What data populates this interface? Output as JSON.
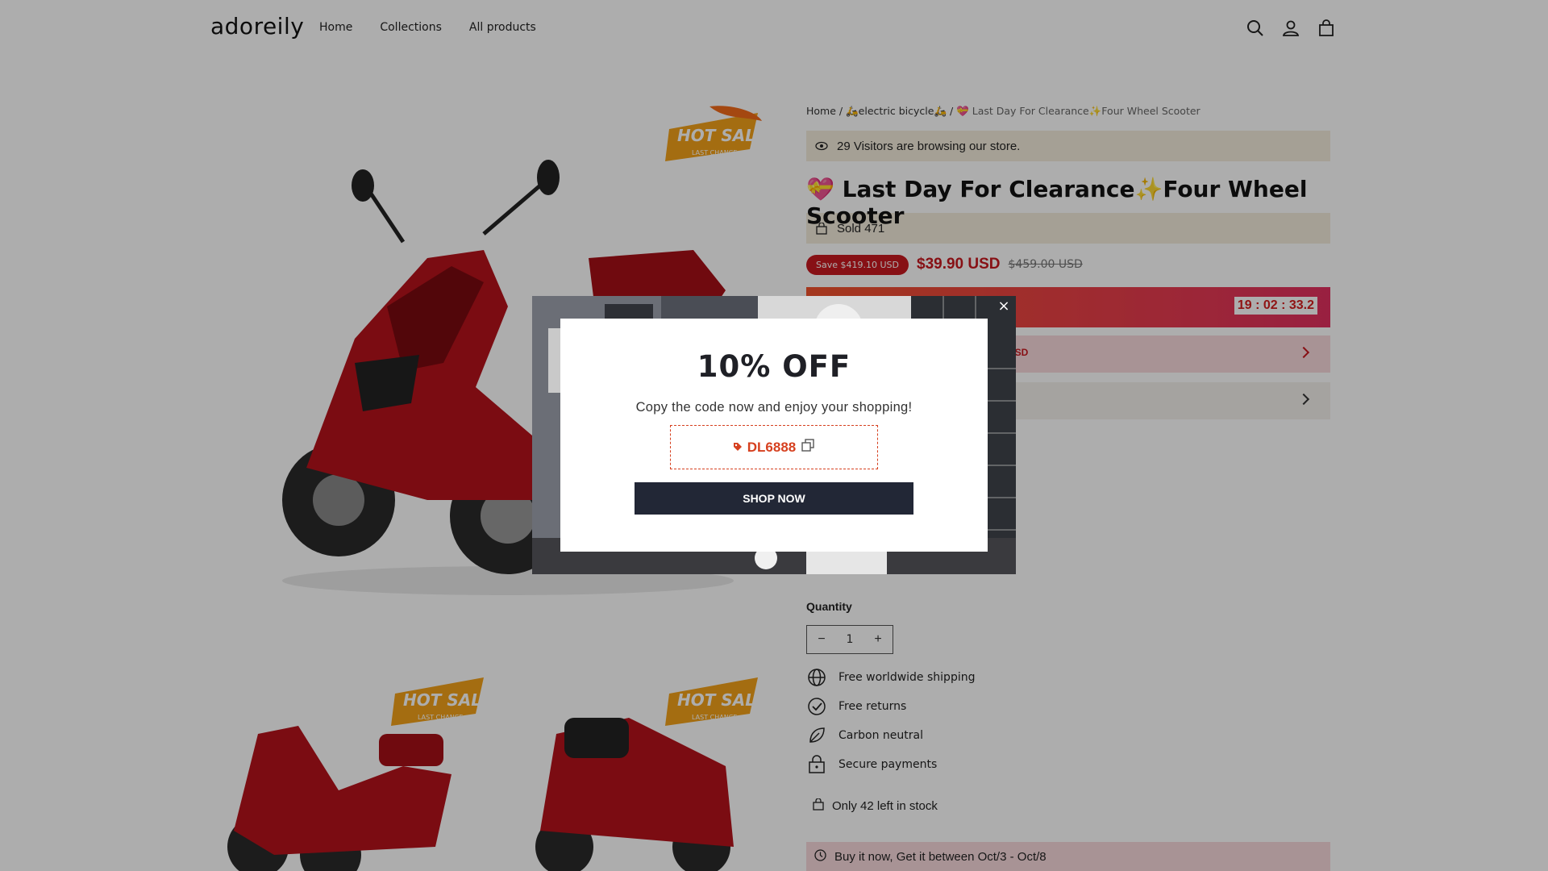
{
  "header": {
    "logo": "adoreily",
    "nav": [
      "Home",
      "Collections",
      "All products"
    ],
    "icons": [
      "search-icon",
      "account-icon",
      "cart-icon"
    ]
  },
  "media": {
    "badge_text": "HOT SALE",
    "badge_subtext": "LAST CHANCE"
  },
  "product": {
    "breadcrumb": {
      "home": "Home",
      "sep1": " / ",
      "category": "🛵electric bicycle🛵",
      "sep2": " / ",
      "current": "💝 Last Day For Clearance✨Four Wheel Scooter"
    },
    "visitors": "29 Visitors are browsing our store.",
    "title": "💝 Last Day For Clearance✨Four Wheel Scooter",
    "sold": "Sold 471",
    "save_badge": "Save $419.10 USD",
    "price": "$39.90 USD",
    "compare_price": "$459.00 USD",
    "timer": "19 : 02 : 33.2",
    "offer_fragment": "USD",
    "quantity_label": "Quantity",
    "quantity_value": "1",
    "features": [
      {
        "icon": "globe-icon",
        "label": "Free worldwide shipping"
      },
      {
        "icon": "check-circle-icon",
        "label": "Free returns"
      },
      {
        "icon": "leaf-icon",
        "label": "Carbon neutral"
      },
      {
        "icon": "lock-icon",
        "label": "Secure payments"
      }
    ],
    "stock": "Only 42 left in stock",
    "delivery": "Buy it now, Get it between Oct/3 - Oct/8"
  },
  "popup": {
    "close": "×",
    "heading": "10% OFF",
    "subtitle": "Copy the code now and enjoy your shopping!",
    "code": "DL6888",
    "cta": "SHOP NOW"
  },
  "colors": {
    "accent_red": "#c8191f",
    "cta_dark": "#222736",
    "code_orange": "#d6401f"
  }
}
